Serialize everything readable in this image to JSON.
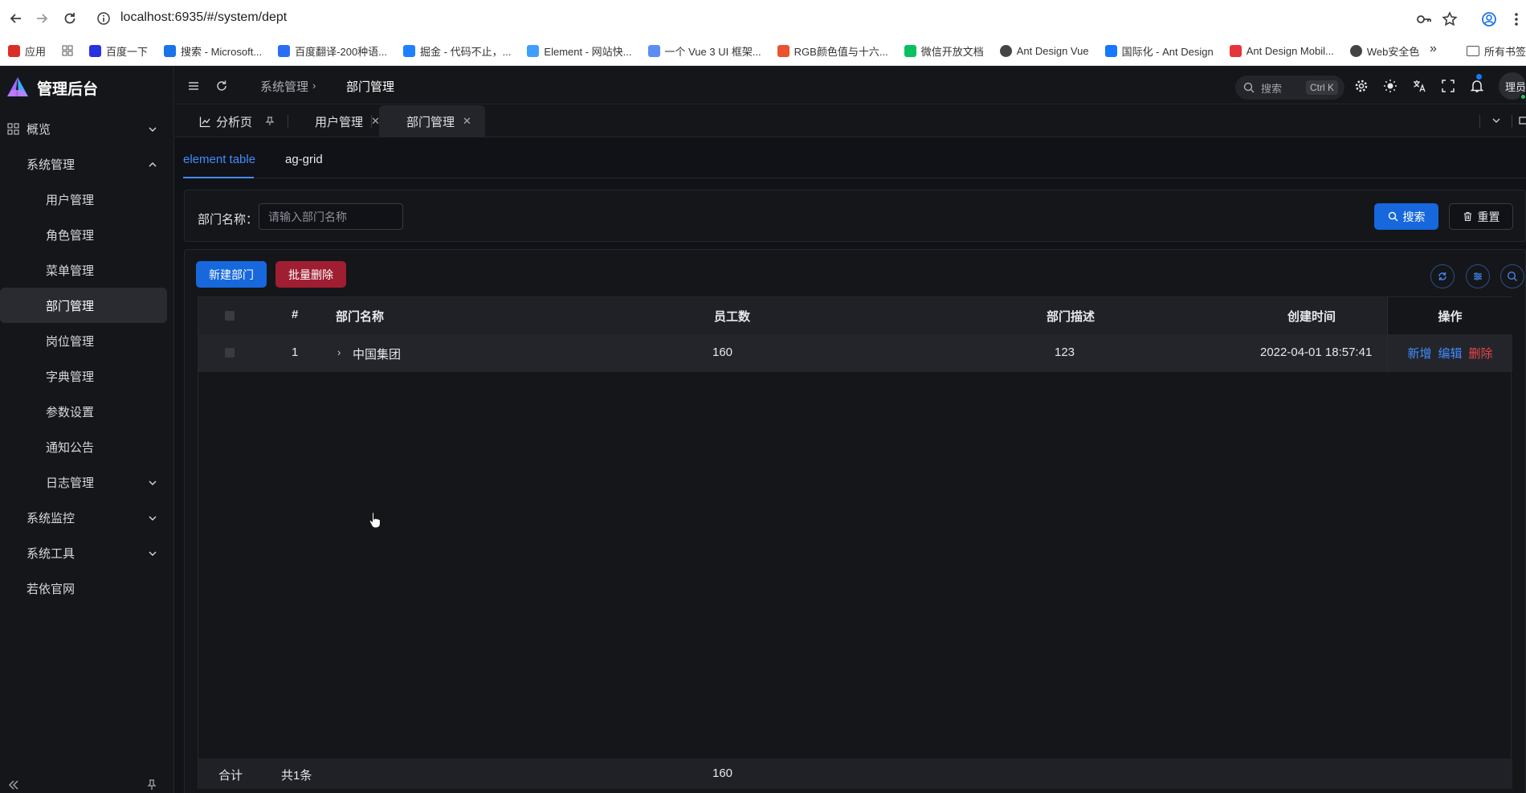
{
  "browser": {
    "url": "localhost:6935/#/system/dept",
    "bookmarks": [
      {
        "label": "应用",
        "icon": "apps-grid-icon",
        "color": "#d93025"
      },
      {
        "label": "百度一下",
        "icon": "baidu-icon",
        "color": "#2932e1"
      },
      {
        "label": "搜索 - Microsoft...",
        "icon": "search-icon",
        "color": "#1a73e8"
      },
      {
        "label": "百度翻译-200种语...",
        "icon": "baidu-translate-icon",
        "color": "#2b6ef5"
      },
      {
        "label": "掘金 - 代码不止，...",
        "icon": "juejin-icon",
        "color": "#1e80ff"
      },
      {
        "label": "Element - 网站快...",
        "icon": "element-icon",
        "color": "#409eff"
      },
      {
        "label": "一个 Vue 3 UI 框架...",
        "icon": "vue-ui-icon",
        "color": "#5b8ef5"
      },
      {
        "label": "RGB颜色值与十六...",
        "icon": "rainbow-icon",
        "color": "#e8542f"
      },
      {
        "label": "微信开放文档",
        "icon": "wechat-icon",
        "color": "#07c160"
      },
      {
        "label": "Ant Design Vue",
        "icon": "globe-icon",
        "color": "#444444"
      },
      {
        "label": "国际化 - Ant Design",
        "icon": "ant-design-icon",
        "color": "#1677ff"
      },
      {
        "label": "Ant Design Mobil...",
        "icon": "ant-mobile-icon",
        "color": "#e6343d"
      },
      {
        "label": "Web安全色",
        "icon": "globe-icon",
        "color": "#444444"
      }
    ],
    "bookmarks_folder": "所有书签"
  },
  "app": {
    "title": "管理后台",
    "menu": [
      {
        "label": "概览",
        "level": 0,
        "icon": "dashboard-grid-icon",
        "chevron": "down"
      },
      {
        "label": "系统管理",
        "level": 0,
        "chevron": "up"
      },
      {
        "label": "用户管理",
        "level": 1
      },
      {
        "label": "角色管理",
        "level": 1
      },
      {
        "label": "菜单管理",
        "level": 1
      },
      {
        "label": "部门管理",
        "level": 1,
        "active": true
      },
      {
        "label": "岗位管理",
        "level": 1
      },
      {
        "label": "字典管理",
        "level": 1
      },
      {
        "label": "参数设置",
        "level": 1
      },
      {
        "label": "通知公告",
        "level": 1
      },
      {
        "label": "日志管理",
        "level": 1,
        "chevron": "down"
      },
      {
        "label": "系统监控",
        "level": 0,
        "chevron": "down"
      },
      {
        "label": "系统工具",
        "level": 0,
        "chevron": "down"
      },
      {
        "label": "若依官网",
        "level": 0
      }
    ]
  },
  "header": {
    "breadcrumb": [
      "系统管理",
      "部门管理"
    ],
    "search_placeholder": "搜索",
    "search_shortcut": "Ctrl K",
    "avatar_text": "理员"
  },
  "tabs": [
    {
      "label": "分析页",
      "trailing": "pin"
    },
    {
      "label": "用户管理",
      "trailing": "close"
    },
    {
      "label": "部门管理",
      "trailing": "close",
      "active": true
    }
  ],
  "subtabs": [
    "element table",
    "ag-grid"
  ],
  "filter": {
    "label": "部门名称：",
    "placeholder": "请输入部门名称",
    "search_btn": "搜索",
    "reset_btn": "重置"
  },
  "toolbar": {
    "new_btn": "新建部门",
    "batch_delete_btn": "批量删除"
  },
  "table": {
    "columns": [
      "#",
      "部门名称",
      "员工数",
      "部门描述",
      "创建时间",
      "操作"
    ],
    "rows": [
      {
        "index": "1",
        "name": "中国集团",
        "employees": "160",
        "description": "123",
        "created": "2022-04-01 18:57:41",
        "actions": [
          "新增",
          "编辑",
          "删除"
        ]
      }
    ],
    "footer": {
      "label": "合计",
      "count": "共1条",
      "employees_total": "160"
    }
  },
  "colors": {
    "primary": "#1668dc",
    "link": "#3f8cff",
    "danger": "#e5484d",
    "danger_btn": "#a01e32",
    "bg": "#111217",
    "panel": "#151619"
  }
}
